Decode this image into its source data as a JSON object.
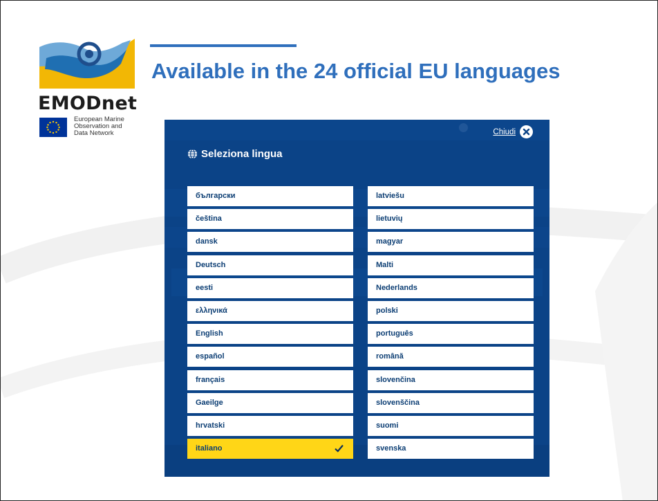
{
  "slide": {
    "title": "Available in the 24 official EU languages"
  },
  "logo": {
    "name": "EMODnet",
    "subtitle": "European Marine\nObservation and\nData Network",
    "colors": {
      "wave_blue": "#1f6fb2",
      "sand": "#f2b705"
    }
  },
  "modal": {
    "close_label": "Chiudi",
    "title": "Seleziona lingua",
    "selected_language": "italiano",
    "left_column": [
      "български",
      "čeština",
      "dansk",
      "Deutsch",
      "eesti",
      "ελληνικά",
      "English",
      "español",
      "français",
      "Gaeilge",
      "hrvatski",
      "italiano"
    ],
    "right_column": [
      "latviešu",
      "lietuvių",
      "magyar",
      "Malti",
      "Nederlands",
      "polski",
      "português",
      "română",
      "slovenčina",
      "slovenščina",
      "suomi",
      "svenska"
    ],
    "colors": {
      "background": "#0b4387",
      "selected": "#ffd617",
      "item_text": "#0b3d73"
    }
  }
}
